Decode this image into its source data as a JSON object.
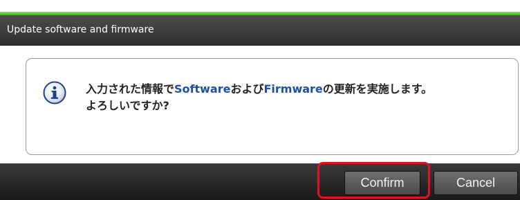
{
  "dialog": {
    "title": "Update software and firmware",
    "accent_color": "#38b81e"
  },
  "message": {
    "icon": "info-icon",
    "line1_part1": "入力された情報で",
    "line1_kw1": "Software",
    "line1_part2": "および",
    "line1_kw2": "Firmware",
    "line1_part3": "の更新を実施します。",
    "line2": "よろしいですか?"
  },
  "buttons": {
    "confirm_label": "Confirm",
    "cancel_label": "Cancel"
  },
  "highlight": {
    "target": "confirm-button",
    "color": "#e0141a"
  }
}
